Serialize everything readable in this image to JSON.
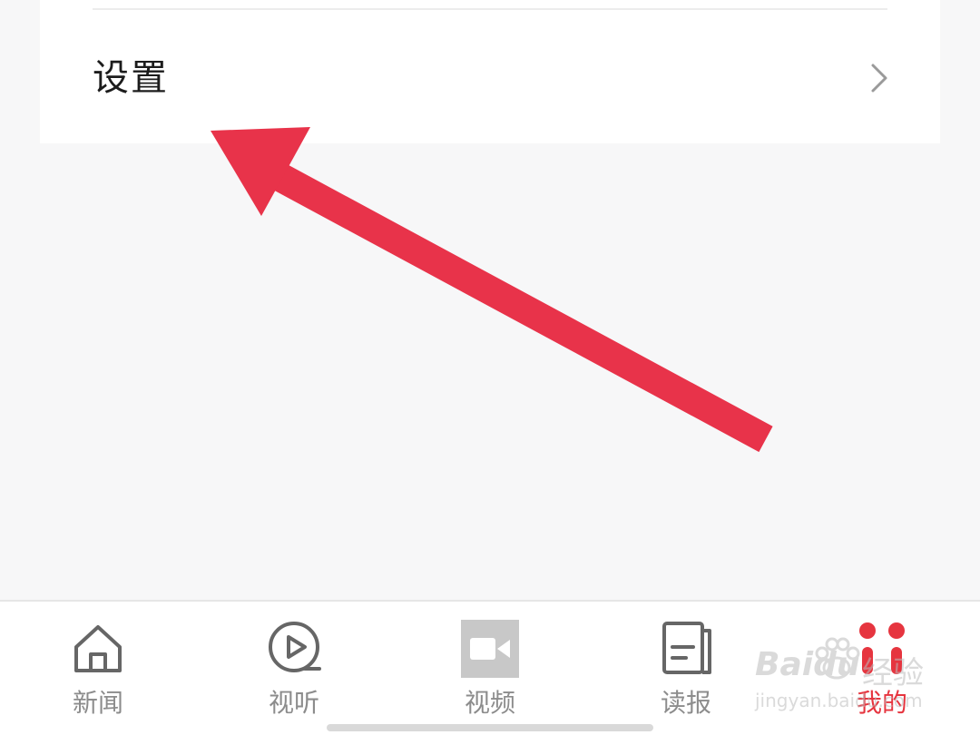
{
  "settings": {
    "label": "设置",
    "chevron_icon": "chevron-right-icon"
  },
  "tabs": [
    {
      "label": "新闻",
      "icon": "home-icon",
      "active": false
    },
    {
      "label": "视听",
      "icon": "play-circle-icon",
      "active": false
    },
    {
      "label": "视频",
      "icon": "video-camera-icon",
      "active": false
    },
    {
      "label": "读报",
      "icon": "newspaper-icon",
      "active": false
    },
    {
      "label": "我的",
      "icon": "user-dots-icon",
      "active": true
    }
  ],
  "watermark": {
    "brand": "Baidu",
    "product": "经验",
    "url": "jingyan.baidu.com"
  },
  "colors": {
    "accent": "#e6353f",
    "annotation_arrow": "#e8334a",
    "inactive": "#8c8c8c",
    "background": "#f7f7f8"
  }
}
